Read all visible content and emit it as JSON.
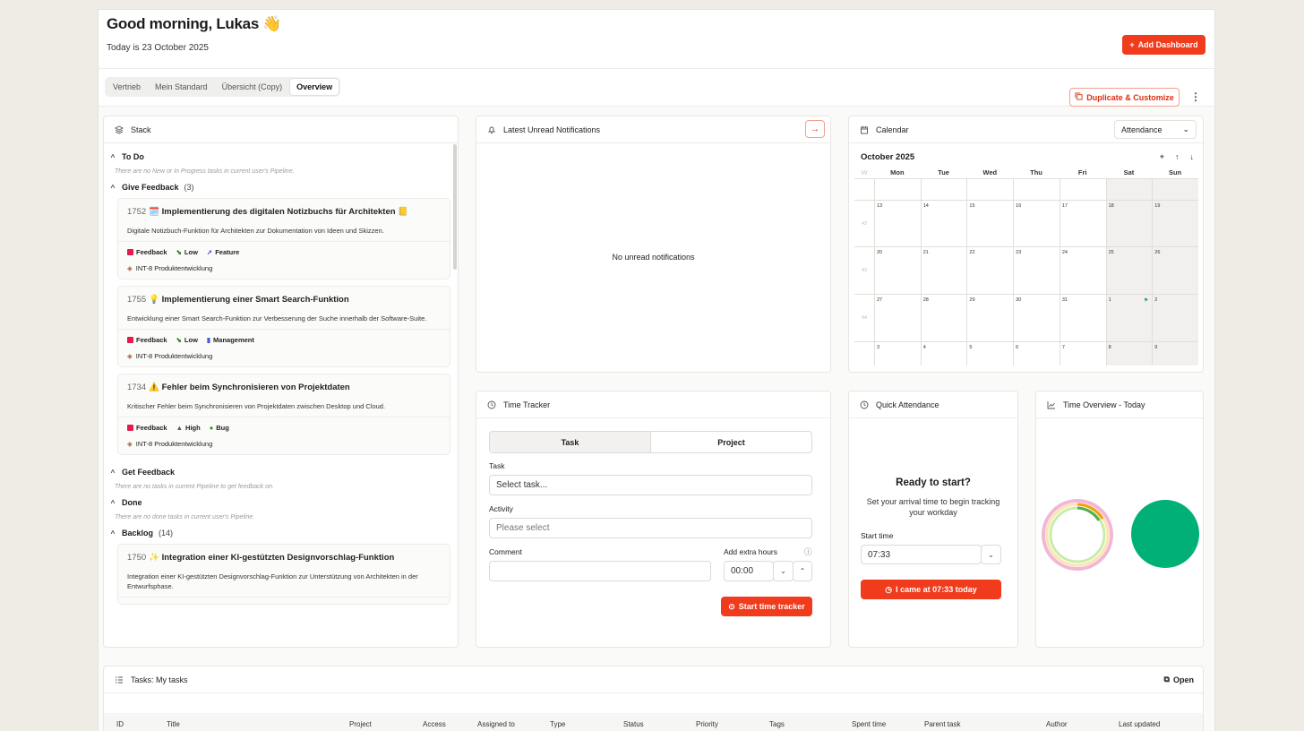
{
  "header": {
    "greeting": "Good morning, Lukas 👋",
    "date_line": "Today is 23 October 2025",
    "add_dashboard": "Add Dashboard"
  },
  "tabs": [
    {
      "label": "Vertrieb",
      "active": false
    },
    {
      "label": "Mein Standard",
      "active": false
    },
    {
      "label": "Übersicht (Copy)",
      "active": false
    },
    {
      "label": "Overview",
      "active": true
    }
  ],
  "toolbar": {
    "duplicate_label": "Duplicate & Customize"
  },
  "stack": {
    "title": "Stack",
    "sections": {
      "todo": {
        "label": "To Do",
        "empty": "There are no New or In Progress tasks in current user's Pipeline."
      },
      "give_feedback": {
        "label": "Give Feedback",
        "count": "(3)"
      },
      "get_feedback": {
        "label": "Get Feedback",
        "empty": "There are no tasks in current Pipeline to get feedback on."
      },
      "done": {
        "label": "Done",
        "empty": "There are no done tasks in current user's Pipeline."
      },
      "backlog": {
        "label": "Backlog",
        "count": "(14)"
      }
    },
    "tasks": [
      {
        "id": "1752",
        "title": "🗓️ Implementierung des digitalen Notizbuchs für Architekten 📒",
        "desc": "Digitale Notizbuch-Funktion für Architekten zur Dokumentation von Ideen und Skizzen.",
        "status": "Feedback",
        "priority": "Low",
        "type": "Feature",
        "project": "INT-8 Produktentwicklung"
      },
      {
        "id": "1755",
        "title": "💡 Implementierung einer Smart Search-Funktion",
        "desc": "Entwicklung einer Smart Search-Funktion zur Verbesserung der Suche innerhalb der Software-Suite.",
        "status": "Feedback",
        "priority": "Low",
        "type": "Management",
        "project": "INT-8 Produktentwicklung"
      },
      {
        "id": "1734",
        "title": "⚠️ Fehler beim Synchronisieren von Projektdaten",
        "desc": "Kritischer Fehler beim Synchronisieren von Projektdaten zwischen Desktop und Cloud.",
        "status": "Feedback",
        "priority": "High",
        "type": "Bug",
        "project": "INT-8 Produktentwicklung"
      },
      {
        "id": "1750",
        "title": "✨ Integration einer KI-gestützten Designvorschlag-Funktion",
        "desc": "Integration einer KI-gestützten Designvorschlag-Funktion zur Unterstützung von Architekten in der Entwurfsphase."
      }
    ]
  },
  "notifications": {
    "title": "Latest Unread Notifications",
    "empty": "No unread notifications"
  },
  "calendar": {
    "title": "Calendar",
    "view": "Attendance",
    "month": "October 2025",
    "week_header": "W",
    "days": [
      "Mon",
      "Tue",
      "Wed",
      "Thu",
      "Fri",
      "Sat",
      "Sun"
    ],
    "rows": [
      {
        "week": "",
        "dates": [
          "",
          "",
          "",
          "",
          "",
          "",
          ""
        ]
      },
      {
        "week": "42",
        "dates": [
          "13",
          "14",
          "15",
          "16",
          "17",
          "18",
          "19"
        ]
      },
      {
        "week": "43",
        "dates": [
          "20",
          "21",
          "22",
          "23",
          "24",
          "25",
          "26"
        ]
      },
      {
        "week": "44",
        "dates": [
          "27",
          "28",
          "29",
          "30",
          "31",
          "1",
          "2"
        ]
      },
      {
        "week": "",
        "dates": [
          "3",
          "4",
          "5",
          "6",
          "7",
          "8",
          "9"
        ]
      }
    ]
  },
  "time_tracker": {
    "title": "Time Tracker",
    "seg_task": "Task",
    "seg_project": "Project",
    "task_label": "Task",
    "task_value": "Select task...",
    "activity_label": "Activity",
    "activity_placeholder": "Please select",
    "comment_label": "Comment",
    "extra_label": "Add extra hours",
    "extra_value": "00:00",
    "start_label": "Start time tracker"
  },
  "quick_attendance": {
    "title": "Quick Attendance",
    "heading": "Ready to start?",
    "sub": "Set your arrival time to begin tracking your workday",
    "start_label": "Start time",
    "start_value": "07:33",
    "button": "I came at 07:33 today"
  },
  "time_overview": {
    "title": "Time Overview - Today"
  },
  "tasks_table": {
    "title": "Tasks: My tasks",
    "open": "Open",
    "columns": [
      "ID",
      "Title",
      "Project",
      "Access",
      "Assigned to",
      "Type",
      "Status",
      "Priority",
      "Tags",
      "Spent time",
      "Parent task",
      "Author",
      "Last updated"
    ]
  },
  "colors": {
    "accent": "#f03b1c",
    "feedback": "#e11d48",
    "green": "#00b077"
  }
}
